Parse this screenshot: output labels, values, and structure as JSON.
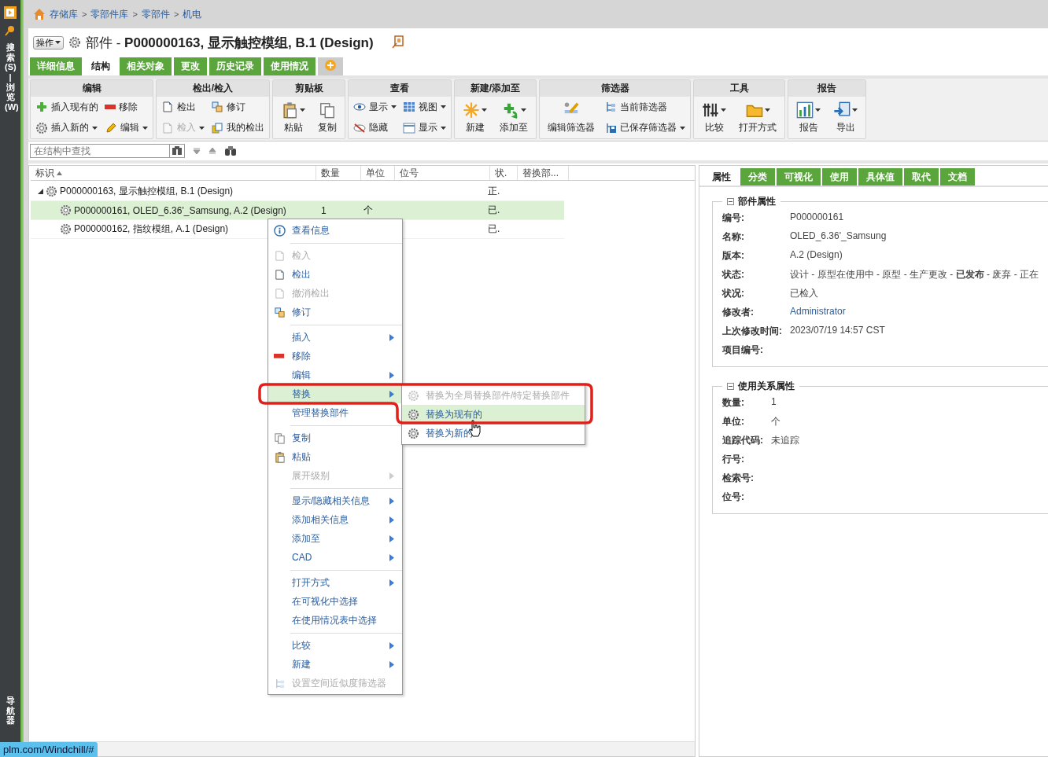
{
  "sidebar": {
    "top_label": "搜索(S) | 浏览(W)",
    "bottom_label": "导航器"
  },
  "breadcrumb": [
    {
      "kind": "link",
      "text": "存储库"
    },
    {
      "kind": "separator",
      "text": ">"
    },
    {
      "kind": "link",
      "text": "零部件库"
    },
    {
      "kind": "separator",
      "text": ">"
    },
    {
      "kind": "link",
      "text": "零部件"
    },
    {
      "kind": "separator",
      "text": ">"
    },
    {
      "kind": "link",
      "text": "机电"
    }
  ],
  "header": {
    "actions_button": "操作",
    "title": "部件 - **P000000163, 显示触控模组, B.1 (Design)**"
  },
  "tabs": [
    {
      "label": "详细信息",
      "selected": false
    },
    {
      "label": "结构",
      "selected": true
    },
    {
      "label": "相关对象",
      "selected": false
    },
    {
      "label": "更改",
      "selected": false
    },
    {
      "label": "历史记录",
      "selected": false
    },
    {
      "label": "使用情况",
      "selected": false
    }
  ],
  "toolbar": [
    {
      "title": "编辑",
      "items": [
        {
          "kind": "small",
          "label": "插入现有的",
          "dropdown": false,
          "disabled": false
        },
        {
          "kind": "small",
          "label": "插入新的",
          "dropdown": true,
          "disabled": false
        },
        {
          "kind": "small",
          "label": "移除",
          "dropdown": false,
          "disabled": false
        },
        {
          "kind": "small",
          "label": "编辑",
          "dropdown": true,
          "disabled": false
        }
      ]
    },
    {
      "title": "检出/检入",
      "items": [
        {
          "kind": "small",
          "label": "检出",
          "dropdown": false,
          "disabled": false
        },
        {
          "kind": "small",
          "label": "检入",
          "dropdown": true,
          "disabled": true
        },
        {
          "kind": "small",
          "label": "修订",
          "dropdown": false,
          "disabled": false
        },
        {
          "kind": "small",
          "label": "我的检出",
          "dropdown": false,
          "disabled": false
        }
      ]
    },
    {
      "title": "剪贴板",
      "items": [
        {
          "kind": "large",
          "label": "粘贴",
          "dropdown": true,
          "disabled": false
        },
        {
          "kind": "large",
          "label": "复制",
          "dropdown": false,
          "disabled": false
        }
      ]
    },
    {
      "title": "查看",
      "items": [
        {
          "kind": "small",
          "label": "显示",
          "dropdown": true,
          "disabled": false
        },
        {
          "kind": "small",
          "label": "隐藏",
          "dropdown": false,
          "disabled": false
        },
        {
          "kind": "small",
          "label": "视图",
          "dropdown": true,
          "disabled": false
        },
        {
          "kind": "small",
          "label": "显示",
          "dropdown": true,
          "disabled": false
        }
      ]
    },
    {
      "title": "新建/添加至",
      "items": [
        {
          "kind": "large",
          "label": "新建",
          "dropdown": true,
          "disabled": false
        },
        {
          "kind": "large",
          "label": "添加至",
          "dropdown": true,
          "disabled": false
        }
      ]
    },
    {
      "title": "筛选器",
      "items": [
        {
          "kind": "large",
          "label": "编辑筛选器",
          "dropdown": false,
          "disabled": false
        },
        {
          "kind": "small",
          "label": "当前筛选器",
          "dropdown": false,
          "disabled": false
        },
        {
          "kind": "small",
          "label": "已保存筛选器",
          "dropdown": true,
          "disabled": false
        }
      ]
    },
    {
      "title": "工具",
      "items": [
        {
          "kind": "large",
          "label": "比较",
          "dropdown": true,
          "disabled": false
        },
        {
          "kind": "large",
          "label": "打开方式",
          "dropdown": true,
          "disabled": false
        }
      ]
    },
    {
      "title": "报告",
      "items": [
        {
          "kind": "large",
          "label": "报告",
          "dropdown": true,
          "disabled": false
        },
        {
          "kind": "large",
          "label": "导出",
          "dropdown": true,
          "disabled": false
        }
      ]
    }
  ],
  "search": {
    "placeholder": "在结构中查找"
  },
  "table": {
    "columns": [
      "标识",
      "数量",
      "单位",
      "位号",
      "状.",
      "替换部..."
    ],
    "rows": [
      {
        "cells": [
          "P000000163, 显示触控模组, B.1 (Design)",
          "",
          "",
          "",
          "正.",
          ""
        ],
        "selected": false,
        "expanded": true,
        "children": [
          {
            "cells": [
              "P000000161, OLED_6.36'_Samsung, A.2 (Design)",
              "1",
              "个",
              "",
              "已.",
              ""
            ],
            "selected": true
          },
          {
            "cells": [
              "P000000162, 指纹模组, A.1 (Design)",
              "",
              "",
              "",
              "已.",
              ""
            ],
            "selected": false
          }
        ]
      }
    ]
  },
  "context_menu": [
    [
      {
        "label": "查看信息",
        "disabled": false,
        "submenu": false,
        "selected": false
      }
    ],
    [
      {
        "label": "检入",
        "disabled": true,
        "submenu": false,
        "selected": false
      },
      {
        "label": "检出",
        "disabled": false,
        "submenu": false,
        "selected": false
      },
      {
        "label": "撤消检出",
        "disabled": true,
        "submenu": false,
        "selected": false
      },
      {
        "label": "修订",
        "disabled": false,
        "submenu": false,
        "selected": false
      }
    ],
    [
      {
        "label": "插入",
        "disabled": false,
        "submenu": true,
        "selected": false
      },
      {
        "label": "移除",
        "disabled": false,
        "submenu": false,
        "selected": false
      },
      {
        "label": "编辑",
        "disabled": false,
        "submenu": true,
        "selected": false
      },
      {
        "label": "替换",
        "disabled": false,
        "submenu": true,
        "selected": true
      },
      {
        "label": "管理替换部件",
        "disabled": false,
        "submenu": false,
        "selected": false
      }
    ],
    [
      {
        "label": "复制",
        "disabled": false,
        "submenu": false,
        "selected": false
      },
      {
        "label": "粘贴",
        "disabled": false,
        "submenu": false,
        "selected": false
      },
      {
        "label": "展开级别",
        "disabled": true,
        "submenu": true,
        "selected": false
      }
    ],
    [
      {
        "label": "显示/隐藏相关信息",
        "disabled": false,
        "submenu": true,
        "selected": false
      },
      {
        "label": "添加相关信息",
        "disabled": false,
        "submenu": true,
        "selected": false
      },
      {
        "label": "添加至",
        "disabled": false,
        "submenu": true,
        "selected": false
      },
      {
        "label": "CAD",
        "disabled": false,
        "submenu": true,
        "selected": false
      }
    ],
    [
      {
        "label": "打开方式",
        "disabled": false,
        "submenu": true,
        "selected": false
      },
      {
        "label": "在可视化中选择",
        "disabled": false,
        "submenu": false,
        "selected": false
      },
      {
        "label": "在使用情况表中选择",
        "disabled": false,
        "submenu": false,
        "selected": false
      }
    ],
    [
      {
        "label": "比较",
        "disabled": false,
        "submenu": true,
        "selected": false
      },
      {
        "label": "新建",
        "disabled": false,
        "submenu": true,
        "selected": false
      },
      {
        "label": "设置空间近似度筛选器",
        "disabled": true,
        "submenu": false,
        "selected": false
      }
    ]
  ],
  "submenu": [
    {
      "label": "替换为全局替换部件/特定替换部件",
      "disabled": true,
      "selected": false
    },
    {
      "label": "替换为现有的",
      "disabled": false,
      "selected": true
    },
    {
      "label": "替换为新的",
      "disabled": false,
      "selected": false
    }
  ],
  "details_tabs": [
    {
      "label": "属性",
      "selected": true
    },
    {
      "label": "分类",
      "selected": false
    },
    {
      "label": "可视化",
      "selected": false
    },
    {
      "label": "使用",
      "selected": false
    },
    {
      "label": "具体值",
      "selected": false
    },
    {
      "label": "取代",
      "selected": false
    },
    {
      "label": "文档",
      "selected": false
    }
  ],
  "sections": [
    {
      "title": "部件属性",
      "expanded": true,
      "fields": [
        {
          "label": "编号:",
          "value": "P000000161"
        },
        {
          "label": "名称:",
          "value": "OLED_6.36'_Samsung"
        },
        {
          "label": "版本:",
          "value": "A.2 (Design)"
        },
        {
          "label": "状态:",
          "value": "设计 - 原型在使用中 - 原型 - 生产更改 - **已发布** - 废弃 - 正在"
        },
        {
          "label": "状况:",
          "value": "已检入"
        },
        {
          "label": "修改者:",
          "value": "Administrator",
          "kind": "link"
        },
        {
          "label": "上次修改时间:",
          "value": "2023/07/19 14:57 CST"
        },
        {
          "label": "项目编号:"
        }
      ]
    },
    {
      "title": "使用关系属性",
      "expanded": true,
      "fields": [
        {
          "label": "数量:",
          "value": "1"
        },
        {
          "label": "单位:",
          "value": "个"
        },
        {
          "label": "追踪代码:",
          "value": "未追踪"
        },
        {
          "label": "行号:"
        },
        {
          "label": "检索号:"
        },
        {
          "label": "位号:"
        }
      ]
    }
  ],
  "status_url": "plm.com/Windchill/#"
}
